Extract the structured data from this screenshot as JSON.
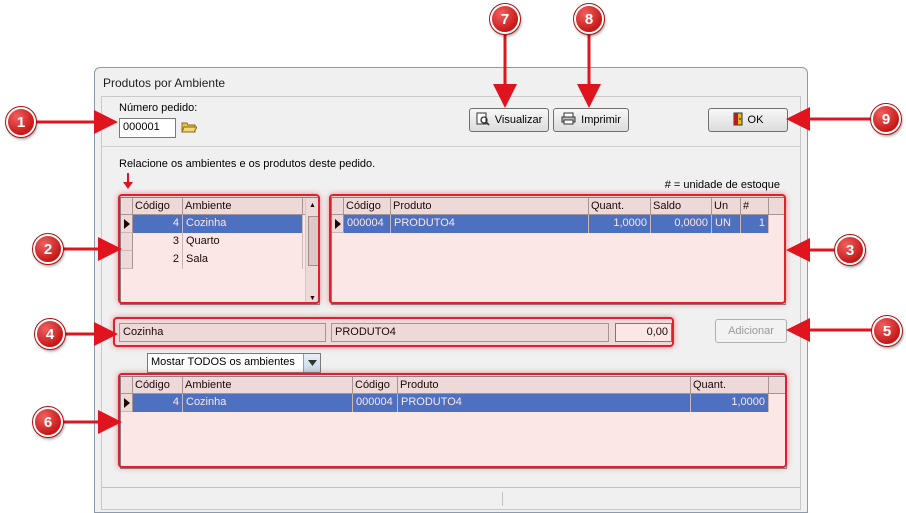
{
  "window": {
    "title": "Produtos por Ambiente"
  },
  "order": {
    "label": "Número pedido:",
    "value": "000001"
  },
  "toolbar": {
    "visualizar": "Visualizar",
    "imprimir": "Imprimir",
    "ok": "OK"
  },
  "instruction": "Relacione os ambientes e os produtos deste pedido.",
  "legend_note": "# = unidade de estoque",
  "env_grid": {
    "headers": [
      "Código",
      "Ambiente"
    ],
    "rows": [
      {
        "codigo": "4",
        "ambiente": "Cozinha"
      },
      {
        "codigo": "3",
        "ambiente": "Quarto"
      },
      {
        "codigo": "2",
        "ambiente": "Sala"
      }
    ]
  },
  "prod_grid": {
    "headers": [
      "Código",
      "Produto",
      "Quant.",
      "Saldo",
      "Un",
      "#"
    ],
    "rows": [
      {
        "codigo": "000004",
        "produto": "PRODUTO4",
        "quant": "1,0000",
        "saldo": "0,0000",
        "un": "UN",
        "hash": "1"
      }
    ]
  },
  "add_bar": {
    "ambiente": "Cozinha",
    "produto": "PRODUTO4",
    "quant": "0,00",
    "button": "Adicionar"
  },
  "filter": {
    "selected": "Mostar TODOS os ambientes"
  },
  "bottom_grid": {
    "headers": [
      "Código",
      "Ambiente",
      "Código",
      "Produto",
      "Quant."
    ],
    "rows": [
      {
        "codigo_amb": "4",
        "ambiente": "Cozinha",
        "codigo_prod": "000004",
        "produto": "PRODUTO4",
        "quant": "1,0000"
      }
    ]
  },
  "callouts": [
    "1",
    "2",
    "3",
    "4",
    "5",
    "6",
    "7",
    "8",
    "9"
  ],
  "colors": {
    "selection": "#3a78d4",
    "callout": "#d42020",
    "highlight": "#e0202a"
  },
  "icons": [
    "folder-open-icon",
    "preview-icon",
    "printer-icon",
    "exit-door-icon"
  ]
}
